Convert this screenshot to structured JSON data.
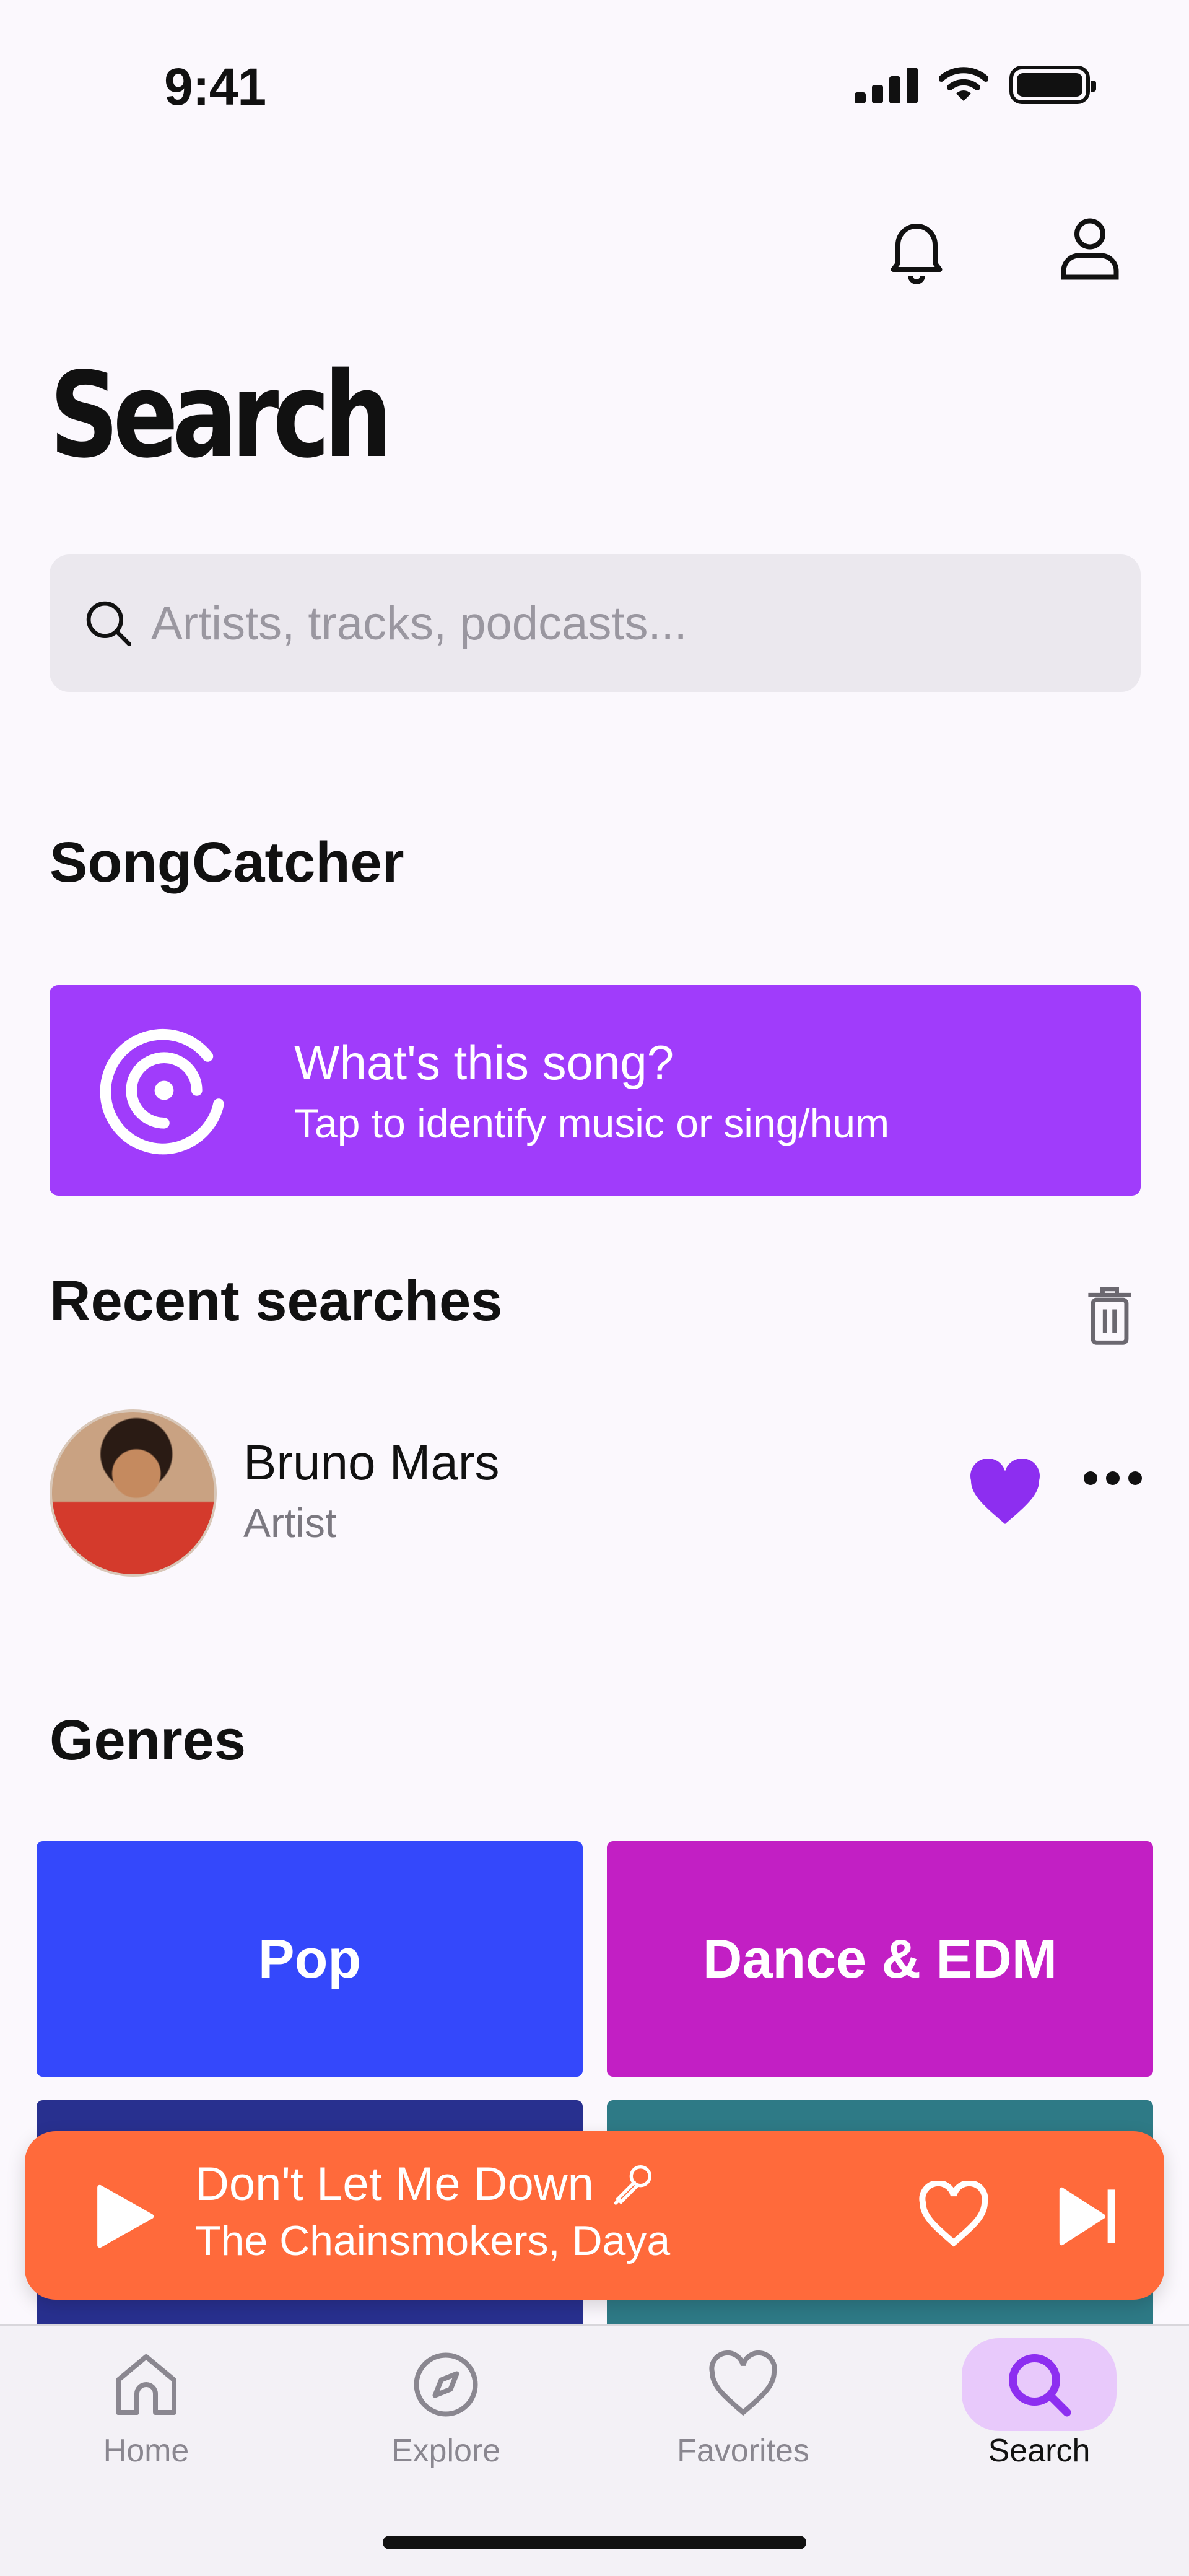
{
  "status_bar": {
    "time": "9:41"
  },
  "header": {
    "title": "Search"
  },
  "search": {
    "placeholder": "Artists, tracks, podcasts..."
  },
  "songcatcher": {
    "section_title": "SongCatcher",
    "card_title": "What's this song?",
    "card_subtitle": "Tap to identify music or sing/hum"
  },
  "recent": {
    "section_title": "Recent searches",
    "items": [
      {
        "name": "Bruno Mars",
        "type": "Artist",
        "liked": true
      }
    ]
  },
  "genres": {
    "section_title": "Genres",
    "items": [
      {
        "label": "Pop",
        "color": "#3448fb"
      },
      {
        "label": "Dance & EDM",
        "color": "#c21fc4"
      },
      {
        "label": "",
        "color": "#28308f"
      },
      {
        "label": "",
        "color": "#2e7a86"
      }
    ]
  },
  "player": {
    "title": "Don't Let Me Down",
    "artist": "The Chainsmokers, Daya",
    "color": "#ff6a3b"
  },
  "tabs": [
    {
      "label": "Home",
      "icon": "home-icon",
      "active": false
    },
    {
      "label": "Explore",
      "icon": "compass-icon",
      "active": false
    },
    {
      "label": "Favorites",
      "icon": "heart-icon",
      "active": false
    },
    {
      "label": "Search",
      "icon": "search-icon",
      "active": true
    }
  ],
  "colors": {
    "accent": "#a03cfb",
    "background": "#fbf8fd"
  }
}
